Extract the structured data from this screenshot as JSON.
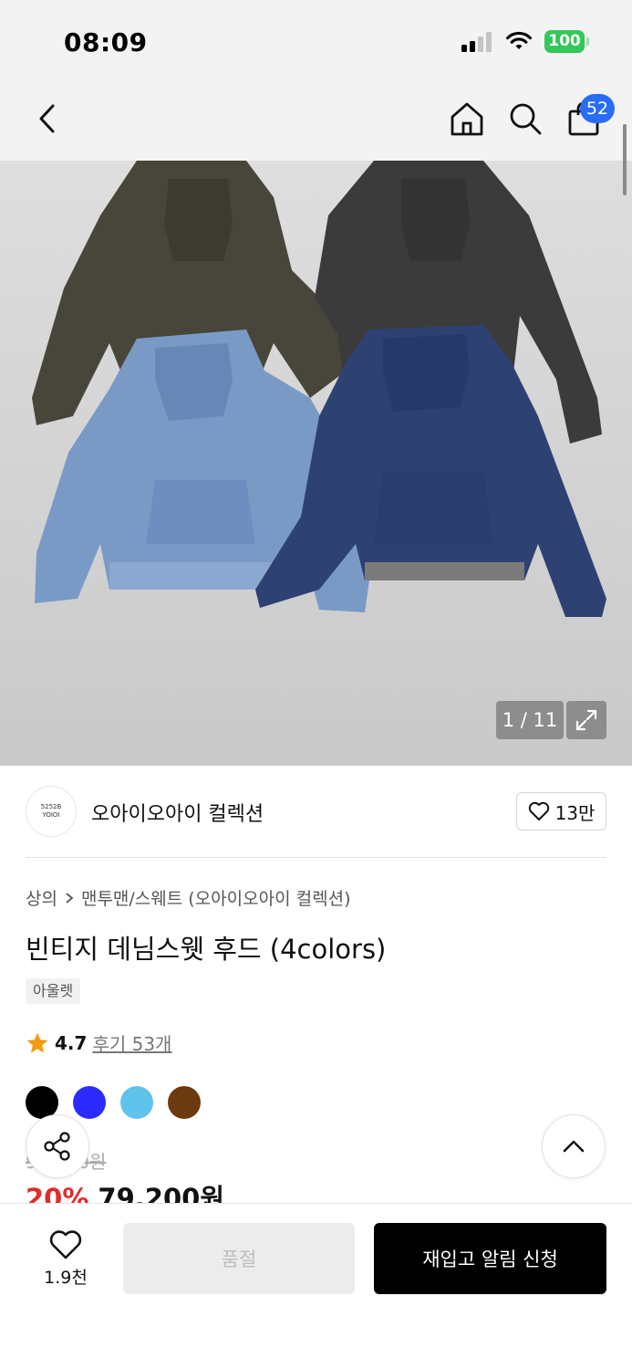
{
  "status_bar": {
    "time": "08:09",
    "battery": "100"
  },
  "header": {
    "cart_count": "52"
  },
  "gallery": {
    "counter": "1 / 11"
  },
  "brand": {
    "logo_line1": "5252B",
    "logo_line2": "YOIOI",
    "name": "오아이오아이 컬렉션",
    "likes": "13만"
  },
  "breadcrumb": {
    "category": "상의",
    "subcategory": "맨투맨/스웨트 (오아이오아이 컬렉션)"
  },
  "product": {
    "title": "빈티지 데님스웻 후드 (4colors)",
    "tag": "아울렛",
    "rating": "4.7",
    "reviews": "후기 53개",
    "colors": [
      "#000000",
      "#2b2bff",
      "#5fc3eb",
      "#6b3a0e"
    ],
    "original_price": "99,000원",
    "discount": "20%",
    "sale_price": "79,200원"
  },
  "bottom_bar": {
    "wish_count": "1.9천",
    "soldout_label": "품절",
    "restock_label": "재입고 알림 신청"
  }
}
